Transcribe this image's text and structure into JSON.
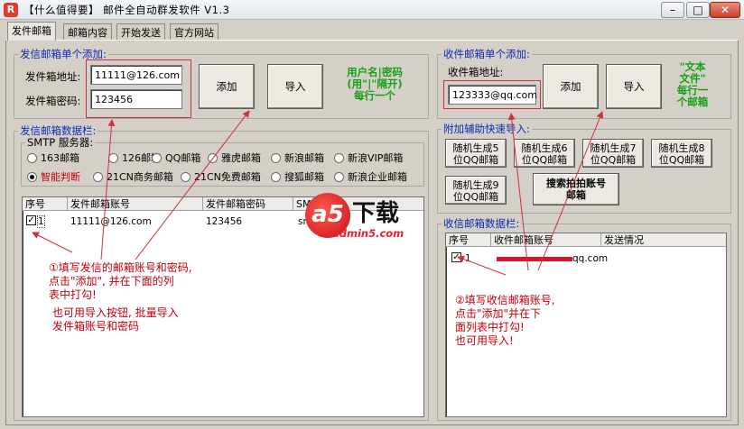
{
  "window": {
    "title": "【什么值得要】 邮件全自动群发软件 V1.3",
    "icon": "R"
  },
  "tabs": [
    "发件邮箱",
    "邮箱内容",
    "开始发送",
    "官方网站"
  ],
  "sender_add": {
    "legend": "发信邮箱单个添加:",
    "address_label": "发件箱地址:",
    "address_value": "11111@126.com",
    "password_label": "发件箱密码:",
    "password_value": "123456",
    "add_label": "添加",
    "import_label": "导入",
    "hint_lines": [
      "用户名|密码",
      "(用\"|\"隔开)",
      "每行一个"
    ]
  },
  "sender_data": {
    "legend": "发信邮箱数据栏:",
    "smtp_legend": "SMTP 服务器:",
    "smtp_options": [
      "163邮箱",
      "126邮箱",
      "QQ邮箱",
      "雅虎邮箱",
      "新浪邮箱",
      "新浪VIP邮箱",
      "智能判断",
      "21CN商务邮箱",
      "21CN免费邮箱",
      "搜狐邮箱",
      "新浪企业邮箱"
    ],
    "smtp_selected": "智能判断",
    "columns": [
      "序号",
      "发件邮箱账号",
      "发件邮箱密码",
      "SM"
    ],
    "rows": [
      {
        "no": "1",
        "account": "11111@126.com",
        "password": "123456",
        "smtp": "sm",
        "checked": true
      }
    ]
  },
  "recv_add": {
    "legend": "收件邮箱单个添加:",
    "address_label": "收件箱地址:",
    "address_value": "123333@qq.com",
    "add_label": "添加",
    "import_label": "导入",
    "hint_lines": [
      "\"文本",
      "文件\"",
      "每行一",
      "个邮箱"
    ]
  },
  "quick_import": {
    "legend": "附加辅助快速导入:",
    "buttons": [
      [
        "随机生成5",
        "位QQ邮箱"
      ],
      [
        "随机生成6",
        "位QQ邮箱"
      ],
      [
        "随机生成7",
        "位QQ邮箱"
      ],
      [
        "随机生成8",
        "位QQ邮箱"
      ],
      [
        "随机生成9",
        "位QQ邮箱"
      ]
    ],
    "search_lines": [
      "搜索拍拍账号",
      "邮箱"
    ]
  },
  "recv_data": {
    "legend": "收信邮箱数据栏:",
    "columns": [
      "序号",
      "收件邮箱账号",
      "发送情况"
    ],
    "rows": [
      {
        "no": "1",
        "account": "qq.com",
        "checked": true
      }
    ]
  },
  "annotations": {
    "note1": [
      "①填写发信的邮箱账号和密码,",
      "点击\"添加\", 并在下面的列",
      "表中打勾!"
    ],
    "note1b": [
      "也可用导入按钮, 批量导入",
      "发件箱账号和密码"
    ],
    "note2": [
      "②填写收信邮箱账号,",
      "点击\"添加\"并在下",
      "面列表中打勾!",
      "也可用导入!"
    ]
  },
  "watermark": {
    "brand": "a5",
    "text": "下载",
    "domain": "admin5.com"
  },
  "colors": {
    "legend": "#0b2cb5",
    "hint_green": "#17a017",
    "annotation_red": "#c0000c",
    "close_red": "#c8412c"
  }
}
